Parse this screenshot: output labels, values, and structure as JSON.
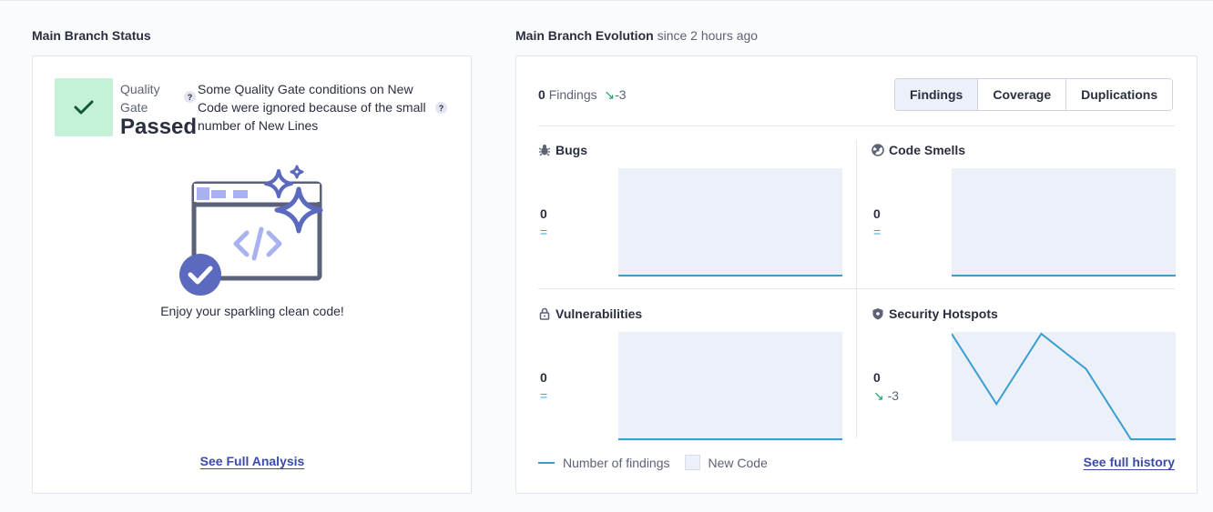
{
  "status": {
    "title": "Main Branch Status",
    "quality_gate_label": "Quality Gate",
    "quality_gate_status": "Passed",
    "message": "Some Quality Gate conditions on New Code were ignored because of the small number of New Lines",
    "help_glyph": "?",
    "clean_text": "Enjoy your sparkling clean code!",
    "see_full_analysis": "See Full Analysis"
  },
  "evolution": {
    "title": "Main Branch Evolution",
    "since": "since 2 hours ago",
    "findings_count": "0",
    "findings_label": "Findings",
    "findings_delta": "-3",
    "tabs": [
      "Findings",
      "Coverage",
      "Duplications"
    ],
    "metrics": [
      {
        "name": "Bugs",
        "value": "0",
        "delta": "="
      },
      {
        "name": "Code Smells",
        "value": "0",
        "delta": "="
      },
      {
        "name": "Vulnerabilities",
        "value": "0",
        "delta": "="
      },
      {
        "name": "Security Hotspots",
        "value": "0",
        "delta": "-3"
      }
    ],
    "legend_findings": "Number of findings",
    "legend_new_code": "New Code",
    "see_full_history": "See full history"
  },
  "colors": {
    "passed_bg": "#c6f1d9",
    "accent": "#3a4ba8",
    "line": "#3a9fd0",
    "new_code_bg": "#ecf0f8",
    "decrease": "#1fa35c"
  },
  "chart_data": [
    {
      "type": "line",
      "title": "Bugs",
      "series": [
        {
          "values": [
            0,
            0,
            0,
            0
          ]
        }
      ]
    },
    {
      "type": "line",
      "title": "Code Smells",
      "series": [
        {
          "values": [
            0,
            0,
            0,
            0
          ]
        }
      ]
    },
    {
      "type": "line",
      "title": "Vulnerabilities",
      "series": [
        {
          "values": [
            0,
            0,
            0,
            0
          ]
        }
      ]
    },
    {
      "type": "line",
      "title": "Security Hotspots",
      "series": [
        {
          "values": [
            3,
            1,
            3,
            2,
            0,
            0
          ]
        }
      ]
    }
  ]
}
